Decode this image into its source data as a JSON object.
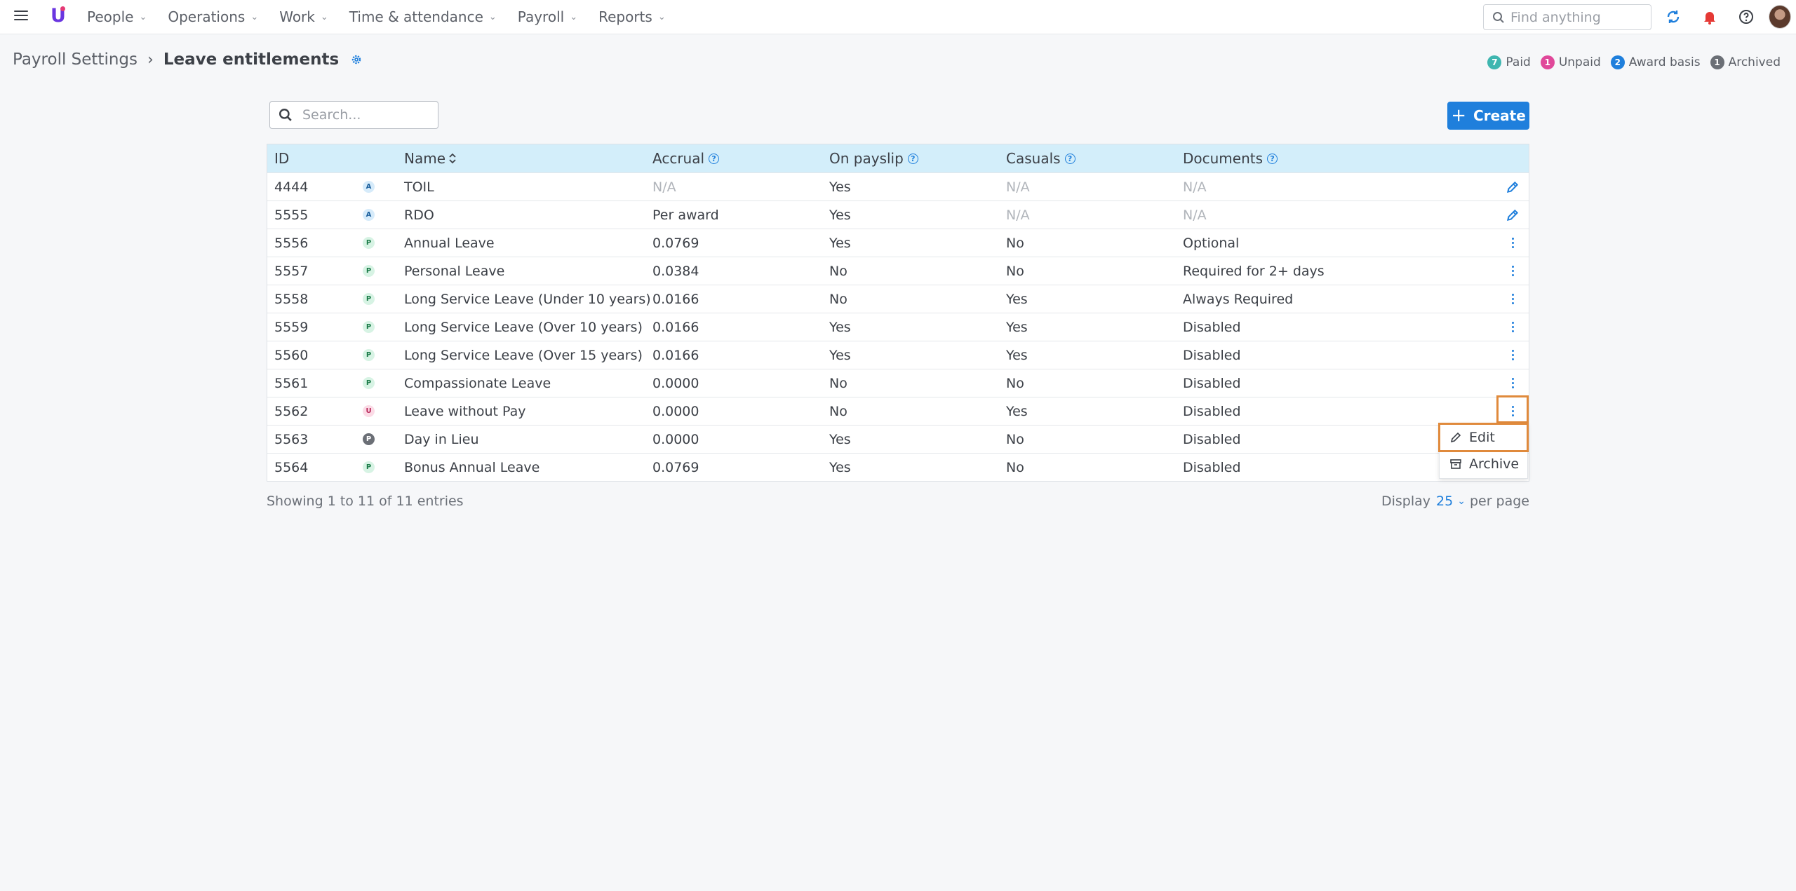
{
  "nav": {
    "items": [
      {
        "label": "People"
      },
      {
        "label": "Operations"
      },
      {
        "label": "Work"
      },
      {
        "label": "Time & attendance"
      },
      {
        "label": "Payroll"
      },
      {
        "label": "Reports"
      }
    ],
    "search_placeholder": "Find anything"
  },
  "breadcrumb": {
    "parent": "Payroll Settings",
    "current": "Leave entitlements"
  },
  "legend": [
    {
      "count": "7",
      "label": "Paid",
      "color": "#3fb6b0"
    },
    {
      "count": "1",
      "label": "Unpaid",
      "color": "#e0489a"
    },
    {
      "count": "2",
      "label": "Award basis",
      "color": "#1f7fdc"
    },
    {
      "count": "1",
      "label": "Archived",
      "color": "#6b6f76"
    }
  ],
  "toolbar": {
    "search_placeholder": "Search...",
    "create_label": "Create"
  },
  "table": {
    "headers": {
      "id": "ID",
      "name": "Name",
      "accrual": "Accrual",
      "on_payslip": "On payslip",
      "casuals": "Casuals",
      "documents": "Documents"
    },
    "rows": [
      {
        "id": "4444",
        "type": "A",
        "name": "TOIL",
        "accrual": "N/A",
        "payslip": "Yes",
        "casuals": "N/A",
        "documents": "N/A",
        "action": "edit"
      },
      {
        "id": "5555",
        "type": "A",
        "name": "RDO",
        "accrual": "Per award",
        "payslip": "Yes",
        "casuals": "N/A",
        "documents": "N/A",
        "action": "edit"
      },
      {
        "id": "5556",
        "type": "P",
        "name": "Annual Leave",
        "accrual": "0.0769",
        "payslip": "Yes",
        "casuals": "No",
        "documents": "Optional",
        "action": "menu"
      },
      {
        "id": "5557",
        "type": "P",
        "name": "Personal Leave",
        "accrual": "0.0384",
        "payslip": "No",
        "casuals": "No",
        "documents": "Required for 2+ days",
        "action": "menu"
      },
      {
        "id": "5558",
        "type": "P",
        "name": "Long Service Leave (Under 10 years)",
        "accrual": "0.0166",
        "payslip": "No",
        "casuals": "Yes",
        "documents": "Always Required",
        "action": "menu"
      },
      {
        "id": "5559",
        "type": "P",
        "name": "Long Service Leave (Over 10 years)",
        "accrual": "0.0166",
        "payslip": "Yes",
        "casuals": "Yes",
        "documents": "Disabled",
        "action": "menu"
      },
      {
        "id": "5560",
        "type": "P",
        "name": "Long Service Leave (Over 15 years)",
        "accrual": "0.0166",
        "payslip": "Yes",
        "casuals": "Yes",
        "documents": "Disabled",
        "action": "menu"
      },
      {
        "id": "5561",
        "type": "P",
        "name": "Compassionate Leave",
        "accrual": "0.0000",
        "payslip": "No",
        "casuals": "No",
        "documents": "Disabled",
        "action": "menu"
      },
      {
        "id": "5562",
        "type": "U",
        "name": "Leave without Pay",
        "accrual": "0.0000",
        "payslip": "No",
        "casuals": "Yes",
        "documents": "Disabled",
        "action": "menu"
      },
      {
        "id": "5563",
        "type": "P",
        "name": "Day in Lieu",
        "accrual": "0.0000",
        "payslip": "Yes",
        "casuals": "No",
        "documents": "Disabled",
        "action": "none"
      },
      {
        "id": "5564",
        "type": "P",
        "name": "Bonus Annual Leave",
        "accrual": "0.0769",
        "payslip": "Yes",
        "casuals": "No",
        "documents": "Disabled",
        "action": "none"
      }
    ]
  },
  "menu": {
    "edit_label": "Edit",
    "archive_label": "Archive"
  },
  "footer": {
    "entries": "Showing 1 to 11 of 11 entries",
    "display_label": "Display",
    "per_page_value": "25",
    "per_page_suffix": "per page"
  }
}
